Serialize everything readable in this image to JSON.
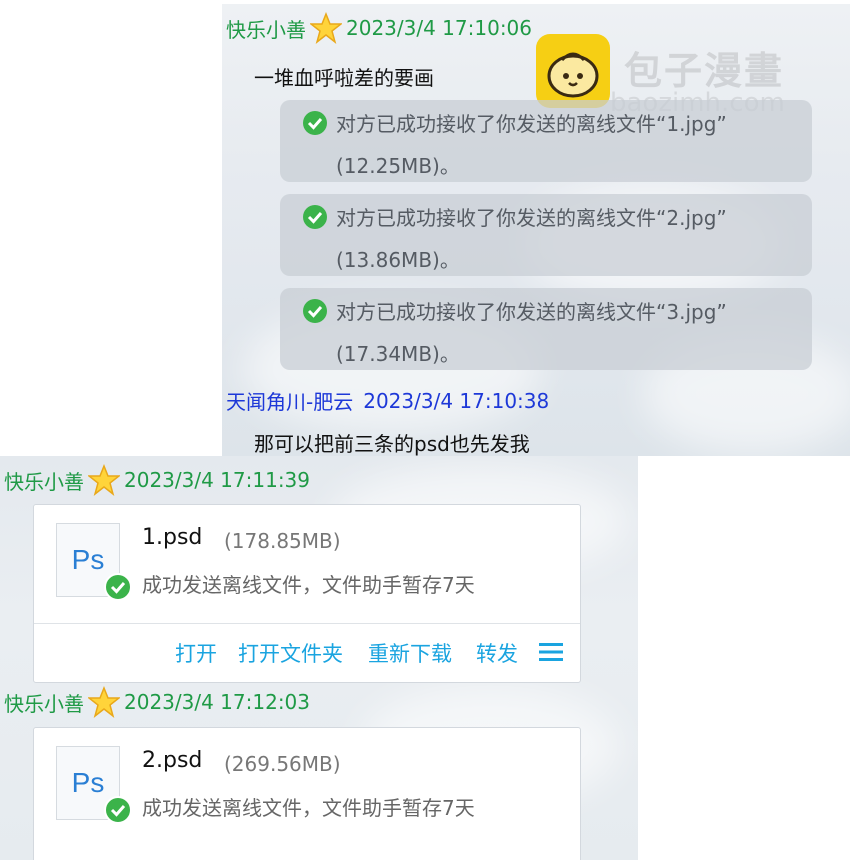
{
  "top_panel": {
    "msg1": {
      "sender": "快乐小善",
      "timestamp": "2023/3/4 17:10:06",
      "text": "一堆血呼啦差的要画",
      "notices": [
        {
          "line1": "对方已成功接收了你发送的离线文件“1.jpg”",
          "line2": "(12.25MB)。"
        },
        {
          "line1": "对方已成功接收了你发送的离线文件“2.jpg”",
          "line2": "(13.86MB)。"
        },
        {
          "line1": "对方已成功接收了你发送的离线文件“3.jpg”",
          "line2": "(17.34MB)。"
        }
      ]
    },
    "msg2": {
      "sender": "天闻角川-肥云",
      "timestamp": "2023/3/4 17:10:38",
      "text": "那可以把前三条的psd也先发我"
    },
    "watermark": {
      "text": "包子漫畫",
      "url": "baozimh.com"
    }
  },
  "bottom_panel": {
    "msg1": {
      "sender": "快乐小善",
      "timestamp": "2023/3/4 17:11:39",
      "file": {
        "icon_label": "Ps",
        "name": "1.psd",
        "size": "(178.85MB)",
        "status": "成功发送离线文件，文件助手暂存7天"
      },
      "actions": [
        "打开",
        "打开文件夹",
        "重新下载",
        "转发"
      ]
    },
    "msg2": {
      "sender": "快乐小善",
      "timestamp": "2023/3/4 17:12:03",
      "file": {
        "icon_label": "Ps",
        "name": "2.psd",
        "size": "(269.56MB)",
        "status": "成功发送离线文件，文件助手暂存7天"
      }
    }
  },
  "colors": {
    "self_sender": "#1f9a46",
    "other_sender": "#1d38d8",
    "link": "#1aa4e0",
    "success": "#3bb34a"
  },
  "icons": [
    "star-icon",
    "check-icon",
    "ps-file-icon",
    "menu-icon",
    "baozi-logo-icon"
  ]
}
